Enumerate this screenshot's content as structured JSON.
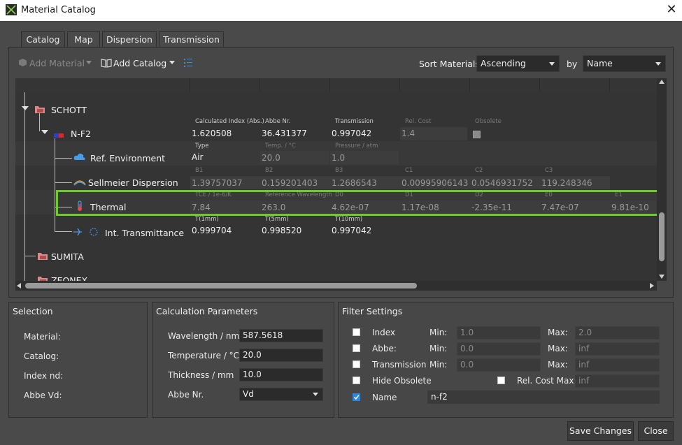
{
  "window": {
    "title": "Material Catalog"
  },
  "tabs": [
    {
      "label": "Catalog",
      "active": true
    },
    {
      "label": "Map"
    },
    {
      "label": "Dispersion"
    },
    {
      "label": "Transmission"
    }
  ],
  "toolbar": {
    "add_material": "Add Material",
    "add_catalog": "Add Catalog",
    "sort_label": "Sort Materials",
    "sort_order": "Ascending",
    "by_label": "by",
    "sort_by": "Name"
  },
  "tree": {
    "schott": "SCHOTT",
    "sumita": "SUMITA",
    "zeonex": "ZEONEX",
    "material": {
      "name": "N-F2",
      "headers": [
        "Calculated Index (Abs.)",
        "Abbe Nr.",
        "Transmission",
        "Rel. Cost",
        "Obsolete"
      ],
      "values": [
        "1.620508",
        "36.431377",
        "0.997042",
        "1.4"
      ]
    },
    "ref_env": {
      "label": "Ref. Environment",
      "headers": [
        "Type",
        "Temp. / °C",
        "Pressure / atm"
      ],
      "values": [
        "Air",
        "20.0",
        "1.0"
      ]
    },
    "sellmeier": {
      "label": "Sellmeier Dispersion",
      "headers": [
        "B1",
        "B2",
        "B3",
        "C1",
        "C2",
        "C3"
      ],
      "values": [
        "1.39757037",
        "0.159201403",
        "1.2686543",
        "0.00995906143",
        "0.0546931752",
        "119.248346"
      ]
    },
    "thermal": {
      "label": "Thermal",
      "headers": [
        "TCE / 1e-6/K",
        "Reference Wavelength",
        "D0",
        "D1",
        "D2",
        "E0",
        "E1"
      ],
      "values": [
        "7.84",
        "263.0",
        "4.62e-07",
        "1.17e-08",
        "-2.35e-11",
        "7.47e-07",
        "9.81e-10"
      ]
    },
    "transmittance": {
      "label": "Int. Transmittance",
      "headers": [
        "T(1mm)",
        "T(5mm)",
        "T(10mm)"
      ],
      "values": [
        "0.999704",
        "0.998520",
        "0.997042"
      ]
    }
  },
  "selection": {
    "title": "Selection",
    "labels": [
      "Material:",
      "Catalog:",
      "Index nd:",
      "Abbe Vd:"
    ]
  },
  "calc": {
    "title": "Calculation Parameters",
    "wavelength_label": "Wavelength / nm",
    "wavelength": "587.5618",
    "temperature_label": "Temperature / °C",
    "temperature": "20.0",
    "thickness_label": "Thickness / mm",
    "thickness": "10.0",
    "abbe_label": "Abbe Nr.",
    "abbe": "Vd"
  },
  "filter": {
    "title": "Filter Settings",
    "min_label": "Min:",
    "max_label": "Max:",
    "index_label": "Index",
    "index_min": "1.0",
    "index_max": "2.0",
    "abbe_label": "Abbe:",
    "abbe_min": "0.0",
    "abbe_max": "inf",
    "trans_label": "Transmission",
    "trans_min": "0.0",
    "trans_max": "inf",
    "hide_obsolete": "Hide Obsolete",
    "relcost_label": "Rel. Cost Max:",
    "relcost_max": "inf",
    "name_label": "Name",
    "name_value": "n-f2"
  },
  "buttons": {
    "save": "Save Changes",
    "close": "Close"
  },
  "colors": {
    "highlight": "#6ecb2b",
    "accent": "#2f86d6",
    "background": "#4a4a4a"
  }
}
